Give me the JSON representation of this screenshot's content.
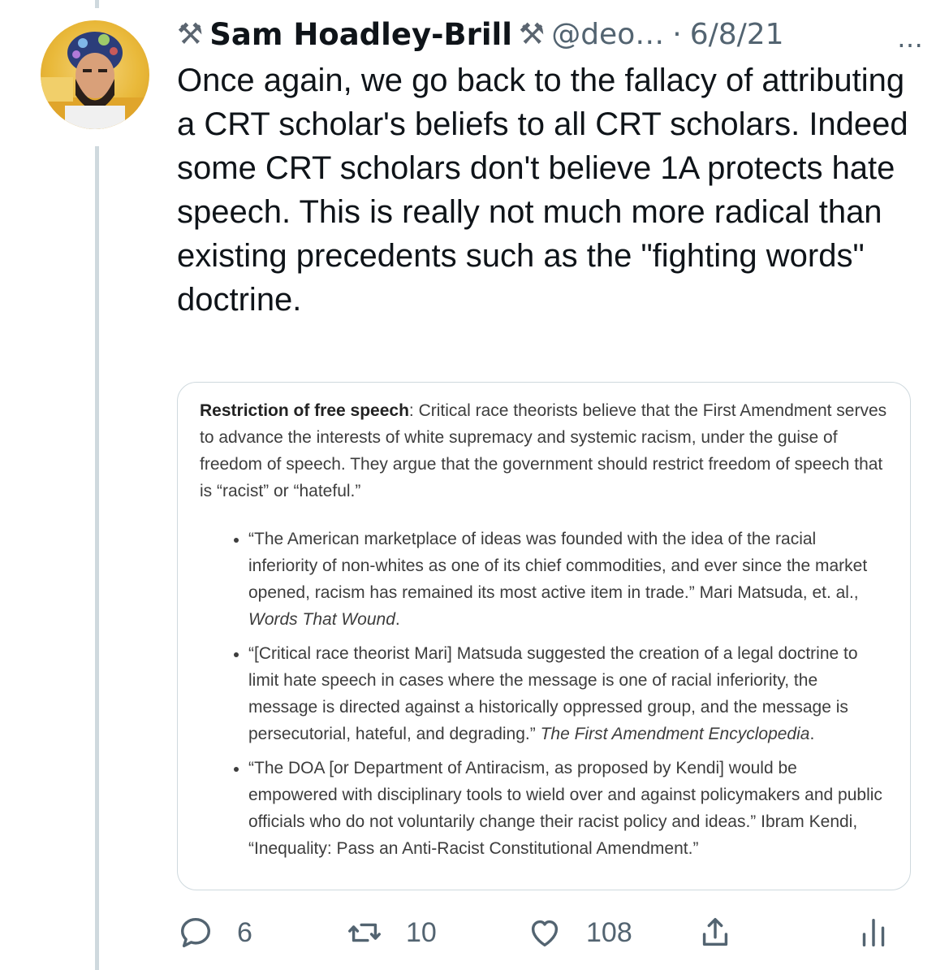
{
  "tweet": {
    "author": {
      "name": "Sam Hoadley-Brill",
      "emoji_left": "⚒",
      "emoji_right": "⚒",
      "handle": "@deo…",
      "separator": "·",
      "date": "6/8/21",
      "more_icon": "…"
    },
    "text": "Once again, we go back to the fallacy of attributing a CRT scholar's beliefs to all CRT scholars. Indeed some CRT scholars don't believe 1A protects hate speech. This is really not much more radical than existing precedents such as the \"fighting words\" doctrine.",
    "quote_image": {
      "heading": "Restriction of free speech",
      "intro": ": Critical race theorists believe that the First Amendment serves to advance the interests of white supremacy and systemic racism, under the guise of freedom of speech. They argue that the government should restrict freedom of speech that is “racist” or “hateful.”",
      "bullets": [
        {
          "text": "“The American marketplace of ideas was founded with the idea of the racial inferiority of non-whites as one of its chief commodities, and ever since the market opened, racism has remained its most active item in trade.” Mari Matsuda, et. al., ",
          "source": "Words That Wound",
          "tail": "."
        },
        {
          "text": "“[Critical race theorist Mari] Matsuda suggested the creation of a legal doctrine to limit hate speech in cases where the message is one of racial inferiority, the message is directed against a historically oppressed group, and the message is persecutorial, hateful, and degrading.” ",
          "source": "The First Amendment Encyclopedia",
          "tail": "."
        },
        {
          "text": "“The DOA [or Department of Antiracism, as proposed by Kendi] would be empowered with disciplinary tools to wield over and against policymakers and public officials who do not voluntarily change their racist policy and ideas.” Ibram Kendi, “Inequality: Pass an Anti-Racist Constitutional Amendment.”",
          "source": "",
          "tail": ""
        }
      ]
    },
    "actions": {
      "reply_count": "6",
      "retweet_count": "10",
      "like_count": "108"
    }
  }
}
